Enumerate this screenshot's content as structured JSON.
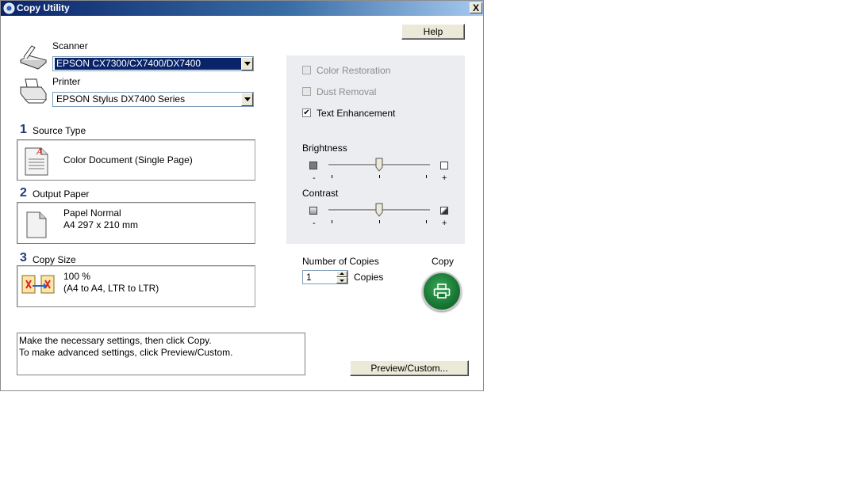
{
  "window": {
    "title": "Copy Utility",
    "close_label": "X"
  },
  "help_button": "Help",
  "scanner": {
    "label": "Scanner",
    "value": "EPSON CX7300/CX7400/DX7400"
  },
  "printer": {
    "label": "Printer",
    "value": "EPSON Stylus DX7400 Series"
  },
  "source_type": {
    "number": "1",
    "label": "Source Type",
    "value": "Color Document (Single Page)"
  },
  "output_paper": {
    "number": "2",
    "label": "Output Paper",
    "line1": "Papel Normal",
    "line2": "A4 297 x 210 mm"
  },
  "copy_size": {
    "number": "3",
    "label": "Copy Size",
    "line1": "100 %",
    "line2": "(A4 to A4, LTR to LTR)"
  },
  "options": {
    "color_restoration": {
      "label": "Color Restoration",
      "checked": false,
      "enabled": false
    },
    "dust_removal": {
      "label": "Dust Removal",
      "checked": false,
      "enabled": false
    },
    "text_enhancement": {
      "label": "Text Enhancement",
      "checked": true,
      "enabled": true,
      "mark": "✔"
    }
  },
  "brightness": {
    "label": "Brightness",
    "minus": "-",
    "plus": "+",
    "level": 0.5
  },
  "contrast": {
    "label": "Contrast",
    "minus": "-",
    "plus": "+",
    "level": 0.5
  },
  "copies": {
    "label": "Number of Copies",
    "value": "1",
    "unit": "Copies"
  },
  "copy_button": {
    "label": "Copy"
  },
  "message": {
    "line1": "Make the necessary settings, then click Copy.",
    "line2": "To make advanced settings, click Preview/Custom."
  },
  "preview_button": "Preview/Custom...",
  "colors": {
    "titlebar": "#0a246a",
    "selected": "#0a246a",
    "copy_green": "#1a7a36",
    "step_number": "#1f3a78"
  }
}
